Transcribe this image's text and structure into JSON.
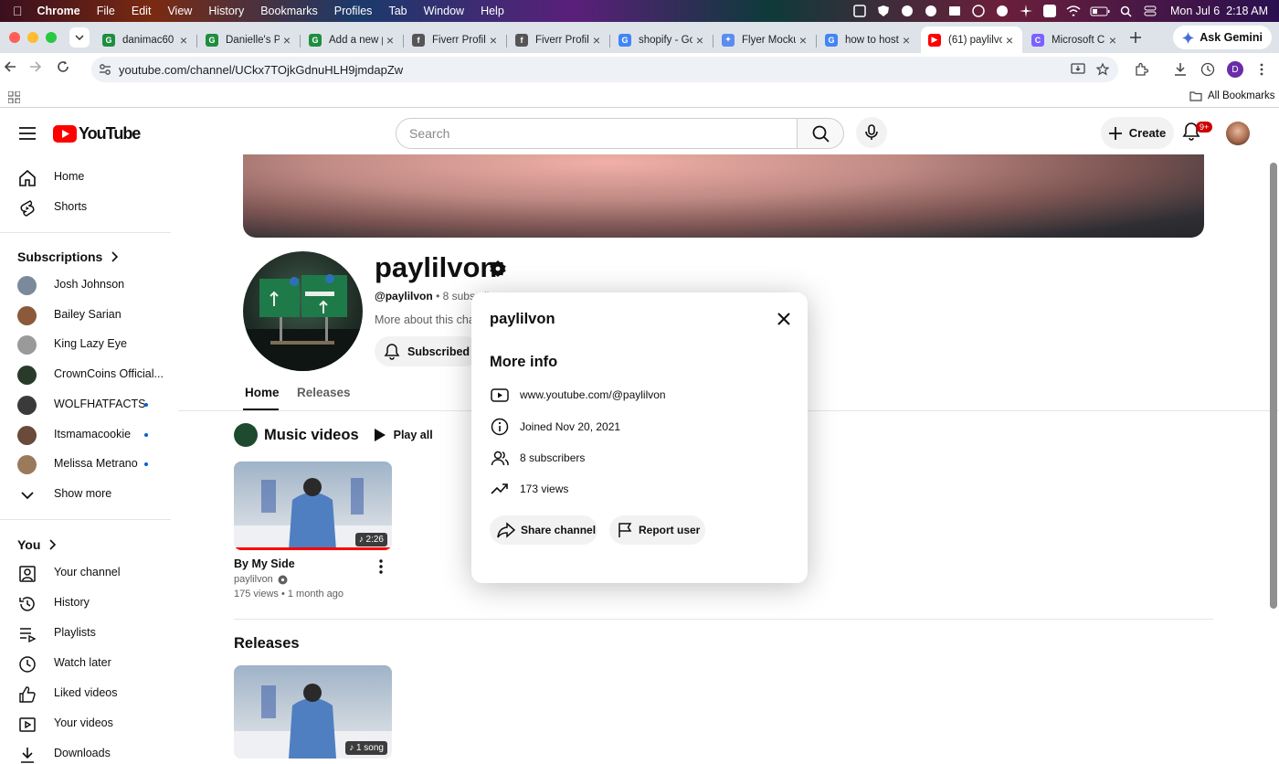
{
  "menubar": {
    "app": "Chrome",
    "items": [
      "File",
      "Edit",
      "View",
      "History",
      "Bookmarks",
      "Profiles",
      "Tab",
      "Window",
      "Help"
    ],
    "clock": "Mon Jul 6  2:18 AM"
  },
  "tabs": [
    {
      "title": "danimac60",
      "favicon": "#1e8e3e",
      "letter": "G"
    },
    {
      "title": "Danielle's P",
      "favicon": "#1e8e3e",
      "letter": "G"
    },
    {
      "title": "Add a new p",
      "favicon": "#1e8e3e",
      "letter": "G"
    },
    {
      "title": "Fiverr Profile",
      "favicon": "#555555",
      "letter": "f"
    },
    {
      "title": "Fiverr Profile",
      "favicon": "#555555",
      "letter": "f"
    },
    {
      "title": "shopify - Go",
      "favicon": "#4285f4",
      "letter": "G"
    },
    {
      "title": "Flyer Mocku",
      "favicon": "#5b8def",
      "letter": "✦"
    },
    {
      "title": "how to host",
      "favicon": "#4285f4",
      "letter": "G"
    },
    {
      "title": "(61) paylilvo",
      "favicon": "#ff0000",
      "letter": "▶"
    },
    {
      "title": "Microsoft C",
      "favicon": "#7b61ff",
      "letter": "C"
    }
  ],
  "browser": {
    "ask_gemini": "Ask Gemini",
    "url": "youtube.com/channel/UCkx7TOjkGdnuHLH9jmdapZw",
    "all_bookmarks": "All Bookmarks"
  },
  "youtube": {
    "logo_text": "YouTube",
    "search_placeholder": "Search",
    "create_label": "Create",
    "notif_badge": "9+"
  },
  "sidebar": {
    "top": [
      {
        "label": "Home",
        "icon": "home-icon"
      },
      {
        "label": "Shorts",
        "icon": "shorts-icon"
      }
    ],
    "subscriptions_heading": "Subscriptions",
    "subscriptions": [
      {
        "name": "Josh Johnson",
        "color": "#7a8a9a",
        "new": false
      },
      {
        "name": "Bailey Sarian",
        "color": "#8a5a3a",
        "new": false
      },
      {
        "name": "King Lazy Eye",
        "color": "#9a9a9a",
        "new": false
      },
      {
        "name": "CrownCoins Official...",
        "color": "#2a3a2a",
        "new": false
      },
      {
        "name": "WOLFHATFACTS",
        "color": "#3a3a3a",
        "new": true
      },
      {
        "name": "Itsmamacookie",
        "color": "#6a4a3a",
        "new": true
      },
      {
        "name": "Melissa Metrano",
        "color": "#9a7a5a",
        "new": true
      }
    ],
    "show_more": "Show more",
    "you_heading": "You",
    "you_items": [
      {
        "label": "Your channel",
        "icon": "your-channel-icon"
      },
      {
        "label": "History",
        "icon": "history-icon"
      },
      {
        "label": "Playlists",
        "icon": "playlists-icon"
      },
      {
        "label": "Watch later",
        "icon": "watch-later-icon"
      },
      {
        "label": "Liked videos",
        "icon": "liked-videos-icon"
      },
      {
        "label": "Your videos",
        "icon": "your-videos-icon"
      },
      {
        "label": "Downloads",
        "icon": "downloads-icon"
      }
    ]
  },
  "channel": {
    "name": "paylilvon",
    "handle": "@paylilvon",
    "subscribers_truncated": "8 subscrib",
    "more_about": "More about this char",
    "subscribed_label": "Subscribed",
    "tabs": [
      "Home",
      "Releases"
    ],
    "music_videos_heading": "Music videos",
    "play_all": "Play all",
    "video": {
      "title": "By My Side",
      "channel": "paylilvon",
      "meta": "175 views • 1 month ago",
      "duration": "2:26"
    },
    "releases_heading": "Releases",
    "release_badge": "1 song"
  },
  "modal": {
    "title": "paylilvon",
    "heading": "More info",
    "rows": [
      {
        "icon": "youtube-link-icon",
        "text": "www.youtube.com/@paylilvon"
      },
      {
        "icon": "info-icon",
        "text": "Joined Nov 20, 2021"
      },
      {
        "icon": "subscribers-icon",
        "text": "8 subscribers"
      },
      {
        "icon": "trending-views-icon",
        "text": "173 views"
      }
    ],
    "share_label": "Share channel",
    "report_label": "Report user"
  }
}
